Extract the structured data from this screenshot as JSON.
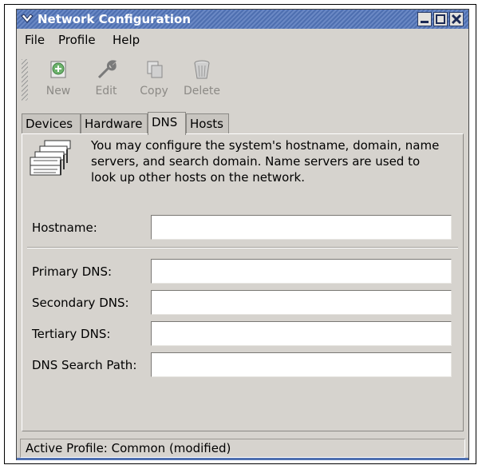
{
  "window": {
    "title": "Network Configuration"
  },
  "menu": {
    "file": "File",
    "profile": "Profile",
    "help": "Help"
  },
  "toolbar": {
    "new": "New",
    "edit": "Edit",
    "copy": "Copy",
    "delete": "Delete"
  },
  "tabs": {
    "devices": "Devices",
    "hardware": "Hardware",
    "dns": "DNS",
    "hosts": "Hosts",
    "active": "DNS"
  },
  "info": "You may configure the system's hostname, domain, name servers, and search domain. Name servers are used to look up other hosts on the network.",
  "fields": {
    "hostname": {
      "label": "Hostname:",
      "value": ""
    },
    "primary_dns": {
      "label": "Primary DNS:",
      "value": ""
    },
    "secondary_dns": {
      "label": "Secondary DNS:",
      "value": ""
    },
    "tertiary_dns": {
      "label": "Tertiary DNS:",
      "value": ""
    },
    "search_path": {
      "label": "DNS Search Path:",
      "value": ""
    }
  },
  "status": "Active Profile: Common (modified)",
  "colors": {
    "titlebar": "#4e6fb0",
    "window_bg": "#d6d3ce"
  }
}
